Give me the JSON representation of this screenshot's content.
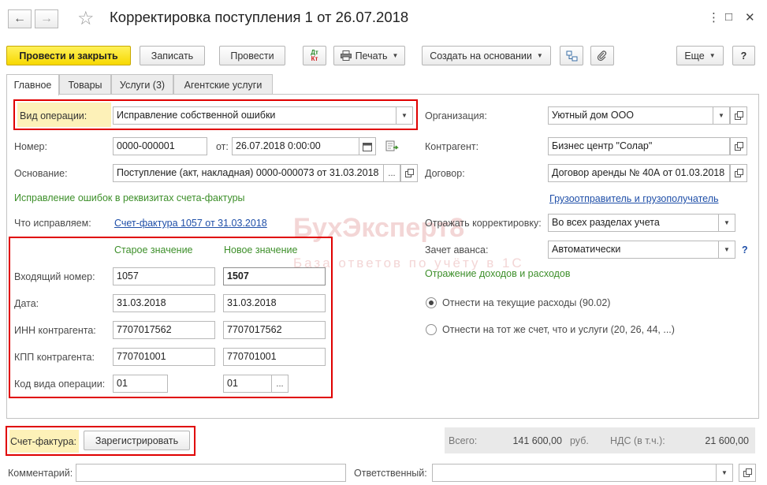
{
  "window": {
    "title": "Корректировка поступления 1 от 26.07.2018",
    "back_glyph": "←",
    "forward_glyph": "→",
    "star_glyph": "☆",
    "more_glyph": "⋮",
    "maximize_glyph": "□",
    "close_glyph": "✕"
  },
  "toolbar": {
    "post_close": "Провести и закрыть",
    "save": "Записать",
    "post": "Провести",
    "dtkt_top": "Дт",
    "dtkt_bottom": "Кт",
    "print": "Печать",
    "create_based": "Создать на основании",
    "more": "Еще",
    "help": "?"
  },
  "tabs": [
    "Главное",
    "Товары",
    "Услуги (3)",
    "Агентские услуги"
  ],
  "form": {
    "operation_type_label": "Вид операции:",
    "operation_type_value": "Исправление собственной ошибки",
    "number_label": "Номер:",
    "number_value": "0000-000001",
    "date_from_label": "от:",
    "date_value": "26.07.2018  0:00:00",
    "basis_label": "Основание:",
    "basis_value": "Поступление (акт, накладная) 0000-000073 от 31.03.2018",
    "invoice_errors_heading": "Исправление ошибок в реквизитах счета-фактуры",
    "what_fix_label": "Что исправляем:",
    "what_fix_value": "Счет-фактура 1057 от 31.03.2018",
    "old_value_header": "Старое значение",
    "new_value_header": "Новое значение",
    "rows": [
      {
        "label": "Входящий номер:",
        "old": "1057",
        "new": "1507"
      },
      {
        "label": "Дата:",
        "old": "31.03.2018",
        "new": "31.03.2018"
      },
      {
        "label": "ИНН контрагента:",
        "old": "7707017562",
        "new": "7707017562"
      },
      {
        "label": "КПП контрагента:",
        "old": "770701001",
        "new": "770701001"
      },
      {
        "label": "Код вида операции:",
        "old": "01",
        "new": "01"
      }
    ],
    "org_label": "Организация:",
    "org_value": "Уютный дом ООО",
    "contractor_label": "Контрагент:",
    "contractor_value": "Бизнес центр \"Солар\"",
    "contract_label": "Договор:",
    "contract_value": "Договор аренды № 40А от 01.03.2018",
    "shipper_link": "Грузоотправитель и грузополучатель",
    "reflect_label": "Отражать корректировку:",
    "reflect_value": "Во всех разделах учета",
    "advance_label": "Зачет аванса:",
    "advance_value": "Автоматически",
    "income_heading": "Отражение доходов и расходов",
    "radio_current": "Отнести на текущие расходы (90.02)",
    "radio_same": "Отнести на тот же счет, что и услуги (20, 26, 44, ...)",
    "ellipsis": "...",
    "question_mark": "?"
  },
  "footer": {
    "invoice_label": "Счет-фактура:",
    "register_button": "Зарегистрировать",
    "total_label": "Всего:",
    "total_value": "141 600,00",
    "currency": "руб.",
    "vat_label": "НДС (в т.ч.):",
    "vat_value": "21 600,00",
    "comment_label": "Комментарий:",
    "comment_value": "",
    "responsible_label": "Ответственный:",
    "responsible_value": ""
  },
  "watermark": {
    "brand": "БухЭксперт8",
    "tagline": "База ответов по учёту в 1С"
  },
  "colors": {
    "primary_button": "#f7d800",
    "highlight_bg": "#fdf1b8",
    "red_outline": "#e00000",
    "green_text": "#3d8f2a",
    "link": "#1f4fa8"
  }
}
